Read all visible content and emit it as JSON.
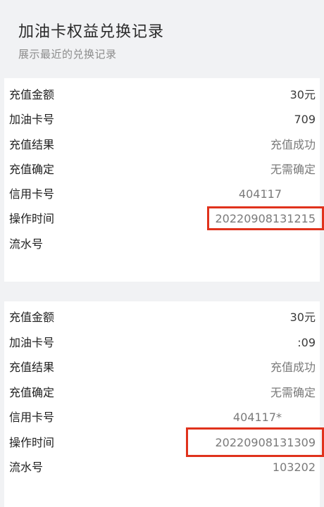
{
  "page": {
    "title": "加油卡权益兑换记录",
    "subtitle": "展示最近的兑换记录"
  },
  "labels": {
    "amount": "充值金额",
    "card_number": "加油卡号",
    "result": "充值结果",
    "confirm": "充值确定",
    "credit_card": "信用卡号",
    "op_time": "操作时间",
    "serial": "流水号"
  },
  "records": [
    {
      "amount": "30元",
      "card_number": "709",
      "result": "充值成功",
      "confirm": "无需确定",
      "credit_card": "404117",
      "op_time": "20220908131215",
      "serial": ""
    },
    {
      "amount": "30元",
      "card_number": ":09",
      "result": "充值成功",
      "confirm": "无需确定",
      "credit_card": "404117*",
      "op_time": "20220908131309",
      "serial": "103202"
    }
  ],
  "colors": {
    "highlight_border": "#e0321c",
    "background": "#f1f2f4",
    "card": "#ffffff"
  }
}
